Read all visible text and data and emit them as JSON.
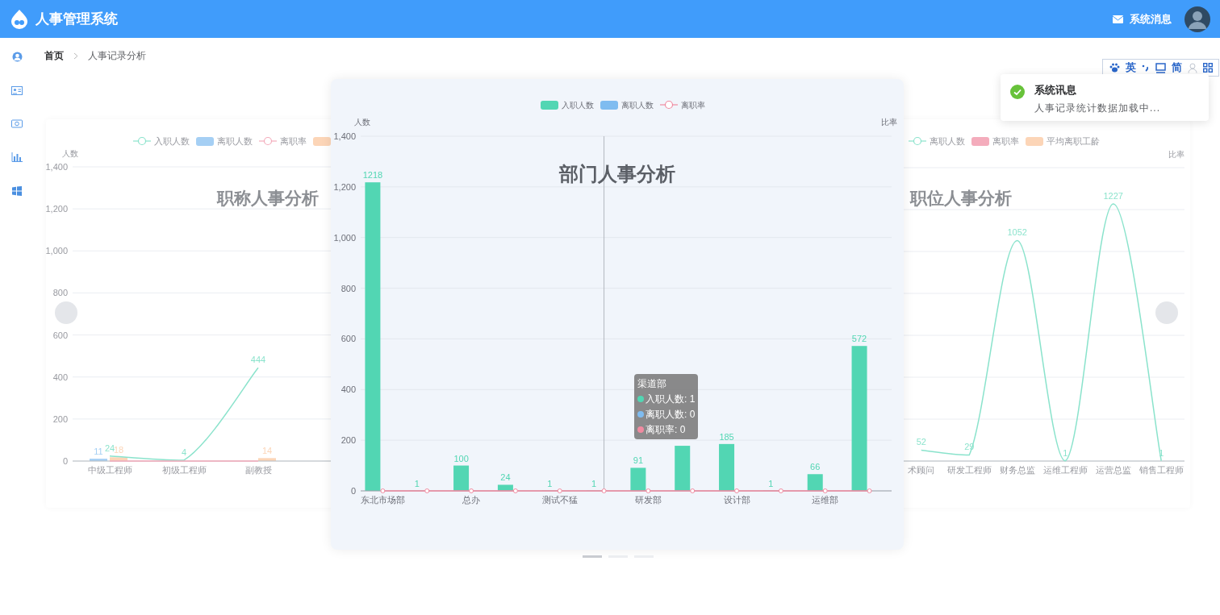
{
  "header": {
    "title": "人事管理系统",
    "message_link": "系统消息"
  },
  "breadcrumb": [
    "首页",
    "人事记录分析"
  ],
  "ime_toolbar": {
    "language": "英",
    "script": "简"
  },
  "notification": {
    "title": "系统讯息",
    "message": "人事记录统计数据加载中..."
  },
  "left_slide": {
    "chart_data": {
      "type": "line",
      "title": "职称人事分析",
      "ylabel": "人数",
      "categories": [
        "中级工程师",
        "初级工程师",
        "副教授"
      ],
      "yticks": [
        {
          "value": 0,
          "label": "0"
        },
        {
          "value": 200,
          "label": "200"
        },
        {
          "value": 400,
          "label": "400"
        },
        {
          "value": 600,
          "label": "600"
        },
        {
          "value": 800,
          "label": "800"
        },
        {
          "value": 1000,
          "label": "1,000"
        },
        {
          "value": 1200,
          "label": "1,200"
        },
        {
          "value": 1400,
          "label": "1,400"
        }
      ],
      "ylim": [
        0,
        1400
      ],
      "grid": true,
      "legend": true,
      "stacked": false,
      "series": [
        {
          "name": "入职人数",
          "color": "#5ad8b7",
          "values": [
            24,
            4,
            444
          ],
          "value_labels": [
            "24",
            "4",
            "444"
          ]
        },
        {
          "name": "离职人数",
          "type": "bar",
          "color": "#7fbcf0",
          "values": [
            11,
            0,
            0
          ],
          "value_labels": [
            "11",
            null,
            null
          ]
        },
        {
          "name": "离职率",
          "color": "#f08aa0",
          "values": [
            0,
            0,
            0
          ]
        },
        {
          "type": "bar",
          "color": "#fbc49a",
          "values": [
            18,
            0,
            14
          ],
          "value_labels": [
            "18",
            null,
            "14"
          ]
        }
      ]
    }
  },
  "center_slide": {
    "right_axis_label": "比率",
    "chart_data": {
      "type": "bar",
      "title": "部门人事分析",
      "ylabel": "人数",
      "categories": [
        "东北市场部",
        null,
        "总办",
        null,
        "测试不猛",
        null,
        "研发部",
        null,
        "设计部",
        null,
        "运维部",
        null
      ],
      "yticks": [
        {
          "value": 0,
          "label": "0"
        },
        {
          "value": 200,
          "label": "200"
        },
        {
          "value": 400,
          "label": "400"
        },
        {
          "value": 600,
          "label": "600"
        },
        {
          "value": 800,
          "label": "800"
        },
        {
          "value": 1000,
          "label": "1,000"
        },
        {
          "value": 1200,
          "label": "1,200"
        },
        {
          "value": 1400,
          "label": "1,400"
        }
      ],
      "ylim": [
        0,
        1400
      ],
      "grid": true,
      "legend": true,
      "stacked": false,
      "series": [
        {
          "name": "入职人数",
          "color": "#52d6b3",
          "values": [
            1218,
            1,
            100,
            24,
            1,
            1,
            91,
            178,
            185,
            1,
            66,
            572
          ],
          "value_labels": [
            "1218",
            "1",
            "100",
            "24",
            "1",
            "1",
            "91",
            null,
            "185",
            "1",
            "66",
            "572"
          ]
        },
        {
          "name": "离职人数",
          "color": "#7fbcf0",
          "values": [
            0,
            0,
            0,
            0,
            0,
            0,
            0,
            0,
            0,
            0,
            0,
            0
          ]
        },
        {
          "name": "离职率",
          "type": "line",
          "marker": true,
          "color": "#f08aa0",
          "values": [
            0,
            0,
            0,
            0,
            0,
            0,
            0,
            0,
            0,
            0,
            0,
            0
          ]
        }
      ]
    },
    "tooltip": {
      "title": "渠道部",
      "rows": [
        {
          "text": "入职人数: 1",
          "color": "#52d6b3"
        },
        {
          "text": "离职人数: 0",
          "color": "#7fbcf0"
        },
        {
          "text": "离职率: 0",
          "color": "#f08aa0"
        }
      ]
    }
  },
  "right_slide": {
    "right_axis_label": "比率",
    "chart_data": {
      "type": "line",
      "title": "职位人事分析",
      "categories": [
        "术顾问",
        "研发工程师",
        "财务总监",
        "运维工程师",
        "运营总监",
        "销售工程师"
      ],
      "ylim": [
        0,
        1400
      ],
      "grid": true,
      "legend": true,
      "series": [
        {
          "name": "离职人数",
          "color": "#5ad8b7",
          "values": [
            52,
            29,
            1052,
            1,
            1227,
            1
          ],
          "value_labels": [
            "52",
            "29",
            "1052",
            "1",
            "1227",
            "1"
          ]
        },
        {
          "name": "离职率",
          "type": "bar",
          "color": "#f08aa0",
          "values": [
            0,
            0,
            0,
            0,
            0,
            0
          ]
        },
        {
          "name": "平均离职工龄",
          "type": "bar",
          "color": "#fbc49a",
          "values": [
            0,
            0,
            0,
            0,
            0,
            0
          ]
        }
      ]
    }
  },
  "carousel_dots": [
    {
      "selected": true
    },
    {
      "selected": false
    },
    {
      "selected": false
    }
  ]
}
